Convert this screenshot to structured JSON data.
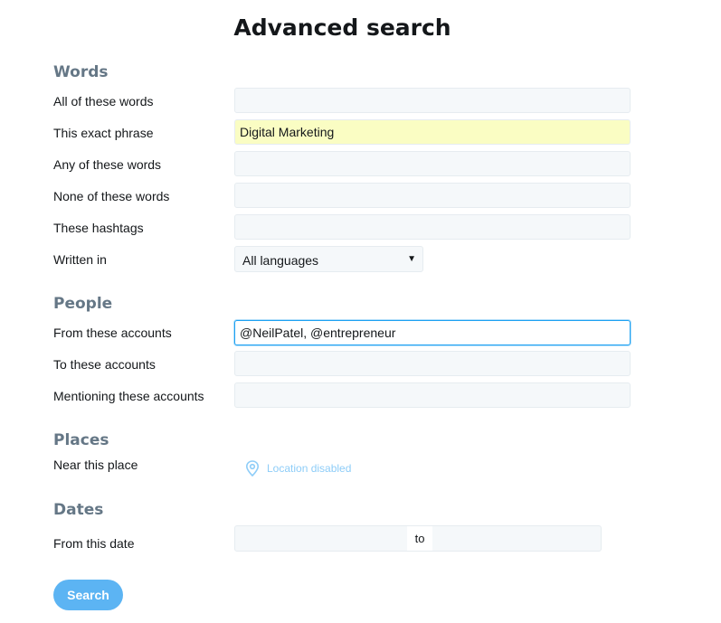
{
  "page": {
    "title": "Advanced search"
  },
  "words": {
    "heading": "Words",
    "all_label": "All of these words",
    "all_value": "",
    "exact_label": "This exact phrase",
    "exact_value": "Digital Marketing",
    "any_label": "Any of these words",
    "any_value": "",
    "none_label": "None of these words",
    "none_value": "",
    "hashtags_label": "These hashtags",
    "hashtags_value": "",
    "written_label": "Written in",
    "written_value": "All languages",
    "written_caret_icon": "caret-down-icon"
  },
  "people": {
    "heading": "People",
    "from_label": "From these accounts",
    "from_value": "@NeilPatel, @entrepreneur",
    "to_label": "To these accounts",
    "to_value": "",
    "mentioning_label": "Mentioning these accounts",
    "mentioning_value": ""
  },
  "places": {
    "heading": "Places",
    "near_label": "Near this place",
    "location_icon": "location-pin-icon",
    "location_text": "Location disabled"
  },
  "dates": {
    "heading": "Dates",
    "from_label": "From this date",
    "to_text": "to"
  },
  "actions": {
    "search_label": "Search"
  },
  "colors": {
    "heading": "#657786",
    "accent": "#1da1f2",
    "button": "#5cb4f3",
    "input_bg": "#f5f8fa",
    "highlight_bg": "#fafdc3",
    "location_text": "#8ecdf8"
  }
}
